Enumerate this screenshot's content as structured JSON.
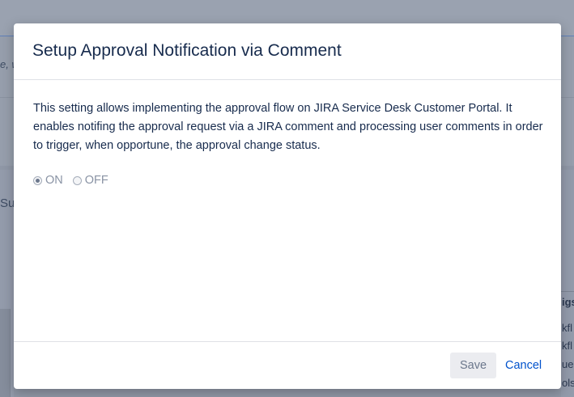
{
  "background": {
    "left_fragments": [
      "e, w",
      "Su"
    ],
    "right_fragments": [
      "igs",
      "kfl",
      "kfl",
      "ue",
      "ols"
    ]
  },
  "dialog": {
    "title": "Setup Approval Notification via Comment",
    "description": "This setting allows implementing the approval flow on JIRA Service Desk Customer Portal. It enables notifing the approval request via a JIRA comment and processing user comments in order to trigger, when opportune, the approval change status.",
    "options": [
      {
        "label": "ON",
        "selected": true
      },
      {
        "label": "OFF",
        "selected": false
      }
    ],
    "save_label": "Save",
    "cancel_label": "Cancel"
  },
  "colors": {
    "title": "#172b4d",
    "link": "#0052cc",
    "overlay": "#8f97a6"
  }
}
